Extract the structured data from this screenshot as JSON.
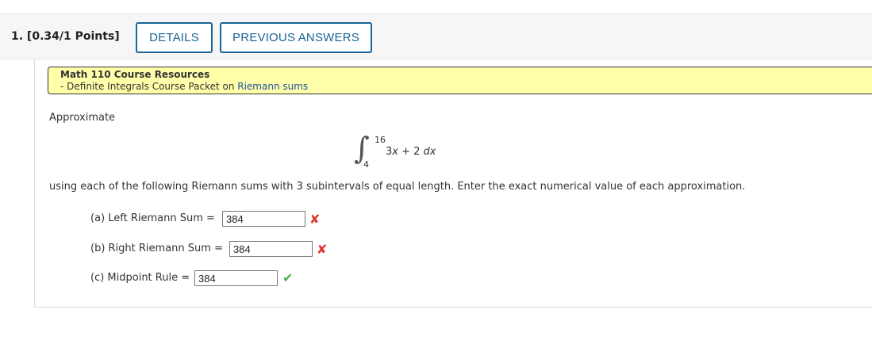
{
  "header": {
    "question_title": "1. [0.34/1 Points]",
    "details_label": "DETAILS",
    "previous_answers_label": "PREVIOUS ANSWERS"
  },
  "resources": {
    "title": "Math 110 Course Resources",
    "line_prefix": "- Definite Integrals Course Packet on ",
    "link_label": "Riemann sums"
  },
  "question": {
    "intro": "Approximate",
    "integral": {
      "upper": "16",
      "lower": "4",
      "integrand_coeff": "3",
      "integrand_var": "x",
      "integrand_rest": " + 2 ",
      "differential": "dx"
    },
    "instruction_prefix": "using each of the following Riemann sums with ",
    "subinterval_count": "3",
    "instruction_suffix": " subintervals of equal length. Enter the exact numerical value of each approximation."
  },
  "answers": [
    {
      "label": "(a) Left Riemann Sum =",
      "value": "384",
      "status": "incorrect"
    },
    {
      "label": "(b) Right Riemann Sum =",
      "value": "384",
      "status": "incorrect"
    },
    {
      "label": "(c) Midpoint Rule =",
      "value": "384",
      "status": "correct"
    }
  ],
  "icons": {
    "incorrect": "x-mark-icon",
    "correct": "check-mark-icon"
  },
  "colors": {
    "accent": "#1a6496",
    "resource_bg": "#ffffaa",
    "link": "#1a4fa0",
    "incorrect": "#e0362c",
    "correct": "#4caf50"
  }
}
